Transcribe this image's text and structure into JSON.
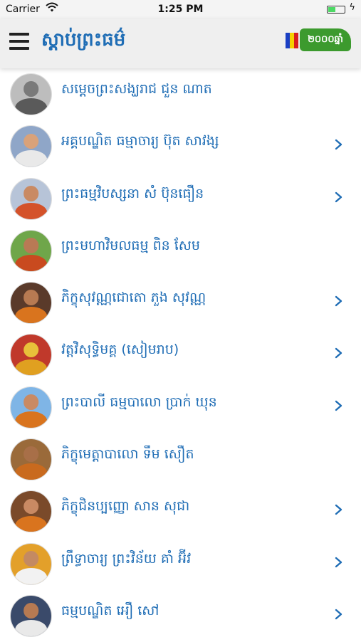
{
  "status_bar": {
    "carrier": "Carrier",
    "time": "1:25 PM",
    "battery_level": 0.4
  },
  "header": {
    "title": "ស្តាប់ព្រះធម៌",
    "badge_label": "២០០០ឆ្នាំ",
    "flag_colors": [
      "#1a3fc4",
      "#f5d000",
      "#d81e1e"
    ],
    "brand_color": "#1f6db5",
    "badge_color": "#3c9a2e"
  },
  "list": {
    "items": [
      {
        "label": "សម្តេចព្រះសង្ឃរាជ ជួន ណាត",
        "has_chevron": false,
        "avatar": {
          "bg": "#bdbdbd",
          "robe": "#5a5a5a",
          "head": "#7a7a7a"
        }
      },
      {
        "label": "អគ្គបណ្ឌិត ធម្មាចារ្យ ប៊ុត សាវង្ស",
        "has_chevron": true,
        "avatar": {
          "bg": "#8fa6c8",
          "robe": "#e9e9e9",
          "head": "#d9a27a"
        }
      },
      {
        "label": "ព្រះធម្មវិបស្សនា សំ ប៊ុនធឿន",
        "has_chevron": true,
        "avatar": {
          "bg": "#b7c4d8",
          "robe": "#d4522a",
          "head": "#c98a63"
        }
      },
      {
        "label": "ព្រះមហាវិមលធម្ម ពិន សែម",
        "has_chevron": false,
        "avatar": {
          "bg": "#6fa64a",
          "robe": "#c94a1f",
          "head": "#b97a55"
        }
      },
      {
        "label": "ភិក្ខុសុវណ្ណជោតោ ភួង សុវណ្ណ",
        "has_chevron": true,
        "avatar": {
          "bg": "#5a3a2a",
          "robe": "#d9741e",
          "head": "#b77a52"
        }
      },
      {
        "label": "វត្តវិសុទ្ធិមគ្គ (សៀមរាប)",
        "has_chevron": true,
        "avatar": {
          "bg": "#c0392b",
          "robe": "#e0a020",
          "head": "#e8c13a"
        }
      },
      {
        "label": "ព្រះបាលី ធម្មបាលោ ប្រាក់ ឃុន",
        "has_chevron": true,
        "avatar": {
          "bg": "#7fb5e6",
          "robe": "#d9741e",
          "head": "#c98a63"
        }
      },
      {
        "label": "ភិក្ខុមេត្តាបាលោ ទឹម សឿត",
        "has_chevron": false,
        "avatar": {
          "bg": "#9a6a3a",
          "robe": "#c96a1e",
          "head": "#a86f48"
        }
      },
      {
        "label": "ភិក្ខុជិនប្បញ្ញោ សាន សុជា",
        "has_chevron": true,
        "avatar": {
          "bg": "#7a4a2a",
          "robe": "#d9741e",
          "head": "#c98a63"
        }
      },
      {
        "label": "ព្រឹទ្ធាចារ្យ ព្រះវិន័យ គាំ អ៊ីវ",
        "has_chevron": true,
        "avatar": {
          "bg": "#e3a02a",
          "robe": "#f2f2f2",
          "head": "#c48a62"
        }
      },
      {
        "label": "ធម្មបណ្ឌិត អឿ សៅ",
        "has_chevron": true,
        "avatar": {
          "bg": "#3a4a6a",
          "robe": "#e9e9e9",
          "head": "#b77a52"
        }
      }
    ]
  }
}
